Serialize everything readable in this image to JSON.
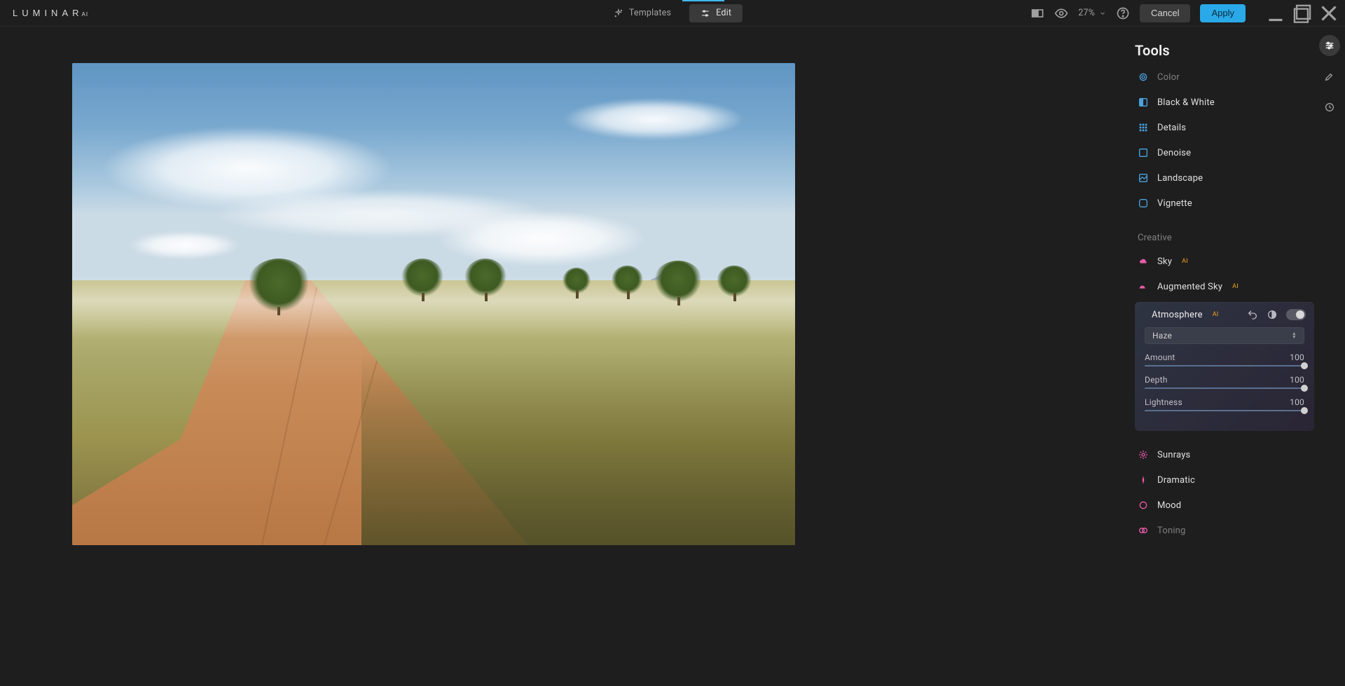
{
  "app": {
    "name": "LUMINAR",
    "name_sup": "AI"
  },
  "top": {
    "templates_label": "Templates",
    "edit_label": "Edit",
    "zoom_label": "27%",
    "cancel_label": "Cancel",
    "apply_label": "Apply"
  },
  "tools_title": "Tools",
  "essentials": {
    "color": "Color",
    "bw": "Black & White",
    "details": "Details",
    "denoise": "Denoise",
    "landscape": "Landscape",
    "vignette": "Vignette"
  },
  "creative_label": "Creative",
  "creative": {
    "sky": "Sky",
    "augmented_sky": "Augmented Sky",
    "atmosphere": "Atmosphere",
    "sunrays": "Sunrays",
    "dramatic": "Dramatic",
    "mood": "Mood",
    "toning": "Toning"
  },
  "ai_badge": "AI",
  "atmosphere": {
    "mode_label": "Haze",
    "sliders": {
      "amount": {
        "label": "Amount",
        "value": "100",
        "pct": 100
      },
      "depth": {
        "label": "Depth",
        "value": "100",
        "pct": 100
      },
      "lightness": {
        "label": "Lightness",
        "value": "100",
        "pct": 100
      }
    }
  }
}
